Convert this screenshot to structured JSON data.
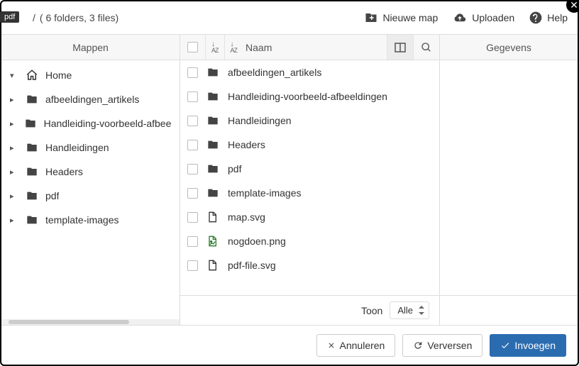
{
  "badge": "pdf",
  "breadcrumb": {
    "path": "/",
    "summary": "( 6 folders, 3 files)"
  },
  "toolbar": {
    "newFolder": "Nieuwe map",
    "upload": "Uploaden",
    "help": "Help"
  },
  "panels": {
    "folders": "Mappen",
    "name": "Naam",
    "info": "Gegevens"
  },
  "tree": [
    {
      "label": "Home",
      "icon": "home",
      "expanded": true
    },
    {
      "label": "afbeeldingen_artikels",
      "icon": "folder",
      "expanded": false
    },
    {
      "label": "Handleiding-voorbeeld-afbeeldingen",
      "icon": "folder",
      "expanded": false
    },
    {
      "label": "Handleidingen",
      "icon": "folder",
      "expanded": false
    },
    {
      "label": "Headers",
      "icon": "folder",
      "expanded": false
    },
    {
      "label": "pdf",
      "icon": "folder",
      "expanded": false
    },
    {
      "label": "template-images",
      "icon": "folder",
      "expanded": false
    }
  ],
  "files": [
    {
      "name": "afbeeldingen_artikels",
      "type": "folder"
    },
    {
      "name": "Handleiding-voorbeeld-afbeeldingen",
      "type": "folder"
    },
    {
      "name": "Handleidingen",
      "type": "folder"
    },
    {
      "name": "Headers",
      "type": "folder"
    },
    {
      "name": "pdf",
      "type": "folder"
    },
    {
      "name": "template-images",
      "type": "folder"
    },
    {
      "name": "map.svg",
      "type": "file"
    },
    {
      "name": "nogdoen.png",
      "type": "image"
    },
    {
      "name": "pdf-file.svg",
      "type": "file"
    }
  ],
  "footer": {
    "showLabel": "Toon",
    "showValue": "Alle"
  },
  "actions": {
    "cancel": "Annuleren",
    "refresh": "Verversen",
    "insert": "Invoegen"
  }
}
